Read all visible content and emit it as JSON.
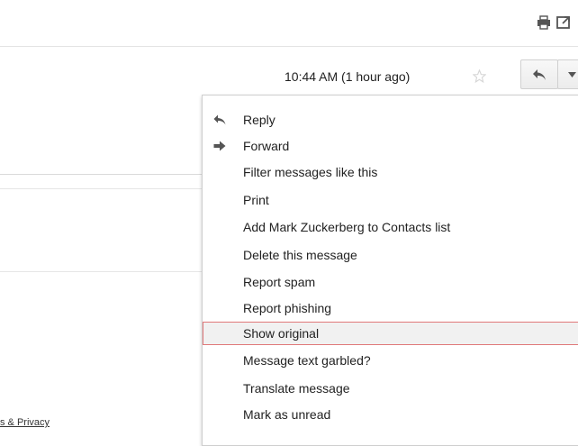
{
  "header": {
    "time": "10:44 AM (1 hour ago)"
  },
  "menu": {
    "items": [
      {
        "label": "Reply",
        "icon": "reply-icon"
      },
      {
        "label": "Forward",
        "icon": "forward-icon"
      },
      {
        "label": "Filter messages like this"
      },
      {
        "label": "Print"
      },
      {
        "label": "Add Mark Zuckerberg to Contacts list"
      },
      {
        "label": "Delete this message"
      },
      {
        "label": "Report spam"
      },
      {
        "label": "Report phishing"
      },
      {
        "label": "Show original",
        "highlighted": true
      },
      {
        "label": "Message text garbled?"
      },
      {
        "label": "Translate message"
      },
      {
        "label": "Mark as unread"
      }
    ]
  },
  "footer": {
    "link": "s & Privacy"
  },
  "colors": {
    "highlight_border": "#e0787a",
    "highlight_bg": "#f1f1f1",
    "icon": "#555555",
    "star": "#d6d6d6"
  }
}
